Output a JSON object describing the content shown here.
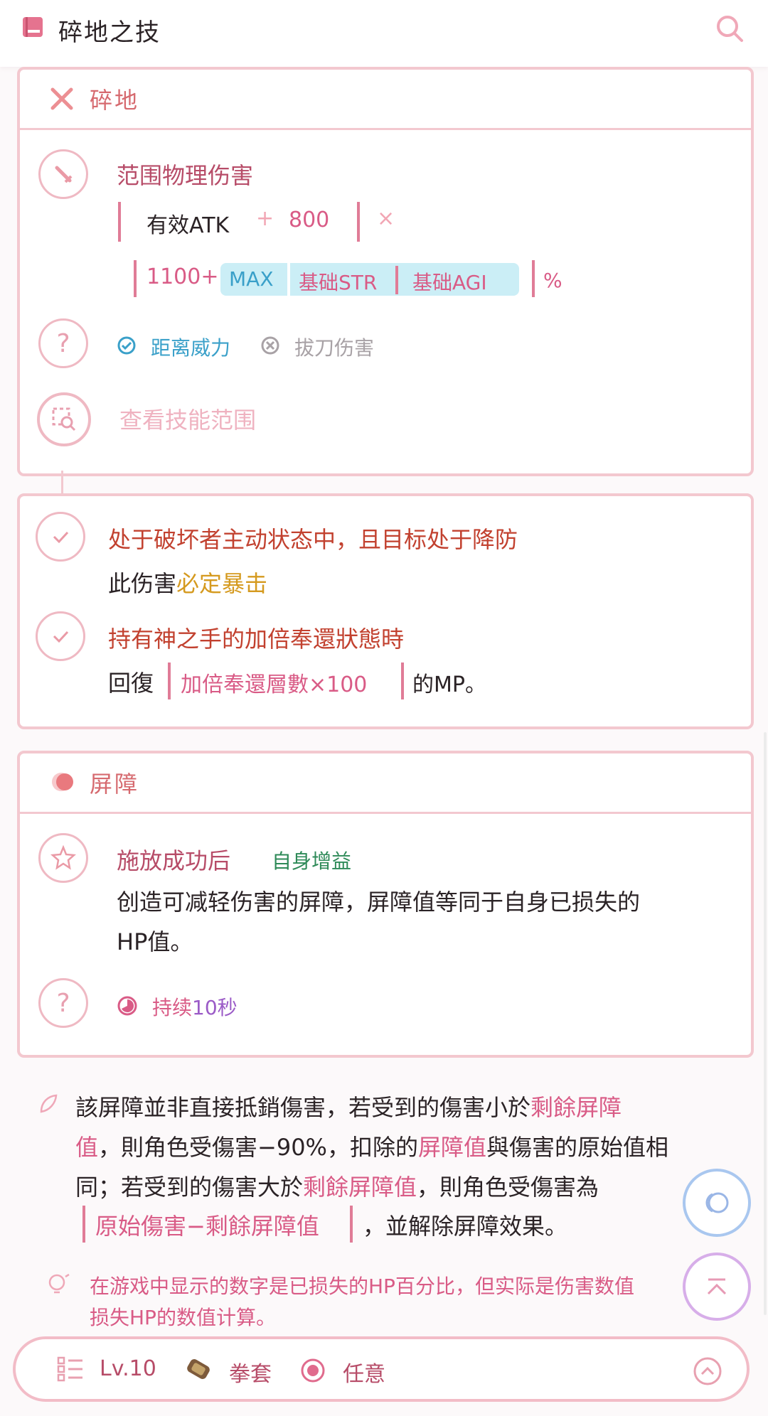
{
  "header": {
    "title": "碎地之技"
  },
  "skill1": {
    "title": "碎地",
    "dmg_type": "范围物理伤害",
    "base": "有效ATK",
    "plus": "+",
    "plus_val": "800",
    "times": "×",
    "mult_base": "1100+",
    "max": "MAX",
    "str": "基础STR",
    "agi": "基础AGI",
    "percent": "%",
    "tag1": "距离威力",
    "tag2": "拔刀伤害",
    "view_range": "查看技能范围"
  },
  "cond": {
    "c1_title": "处于破坏者主动状态中，且目标处于降防",
    "c1_desc_a": "此伤害",
    "c1_desc_b": "必定暴击",
    "c2_title": "持有神之手的加倍奉還狀態時",
    "c2_desc_a": "回復",
    "c2_formula": "加倍奉還層數×100",
    "c2_desc_b": "的MP。"
  },
  "skill2": {
    "title": "屏障",
    "trigger": "施放成功后",
    "buff": "自身增益",
    "desc": "创造可减轻伤害的屏障，屏障值等同于自身已损失的",
    "desc2": "HP值。",
    "duration_a": "持续",
    "duration_b": "10秒"
  },
  "note": {
    "l1a": "該屏障並非直接抵銷傷害，若受到的傷害小於",
    "l1b": "剩餘屏障",
    "l2a": "值",
    "l2b": "，則角色受傷害−90%，扣除的",
    "l2c": "屏障值",
    "l2d": "與傷害的原始值相",
    "l3a": "同；若受到的傷害大於",
    "l3b": "剩餘屏障值",
    "l3c": "，則角色受傷害為",
    "l4a": "原始傷害−剩餘屏障值",
    "l4b": "，並解除屏障效果。"
  },
  "tip": {
    "l1": "在游戏中显示的数字是已损失的HP百分比，但实际是伤害数值",
    "l2": "损失HP的数值计算。"
  },
  "bottom": {
    "level": "Lv.10",
    "weapon": "拳套",
    "target": "任意"
  },
  "colors": {
    "accent": "#d95b86",
    "border": "#f3c8cf",
    "teal": "#3aa0c9"
  }
}
